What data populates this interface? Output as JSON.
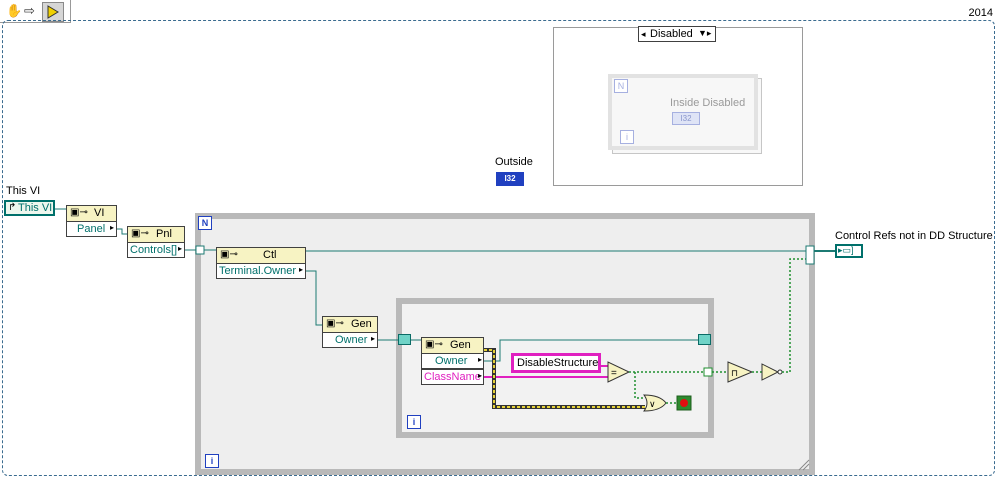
{
  "version": "2014",
  "toolbar": {
    "icons": [
      "hand-icon",
      "arrow-icon",
      "run-icon"
    ]
  },
  "disabled_structure": {
    "selector_label": "Disabled",
    "inside_label": "Inside Disabled",
    "loop_n": "N",
    "loop_i": "i",
    "i32_text": "I32"
  },
  "outside": {
    "label": "Outside",
    "i32_text": "I32"
  },
  "this_vi": {
    "title": "This VI",
    "constant_label": "This VI"
  },
  "nodes": {
    "vi_node": {
      "title": "VI",
      "property": "Panel"
    },
    "pnl_node": {
      "title": "Pnl",
      "property": "Controls[]"
    },
    "ctl_node": {
      "title": "Ctl",
      "property": "Terminal.Owner"
    },
    "gen_node_outer": {
      "title": "Gen",
      "property": "Owner"
    },
    "gen_node_inner": {
      "title": "Gen",
      "property_1": "Owner",
      "property_2": "ClassName"
    }
  },
  "string_constant": "DisableStructure",
  "loop_labels": {
    "outer_n": "N",
    "outer_i": "i",
    "inner_i": "i"
  },
  "output": {
    "label": "Control Refs not in DD Structure"
  }
}
